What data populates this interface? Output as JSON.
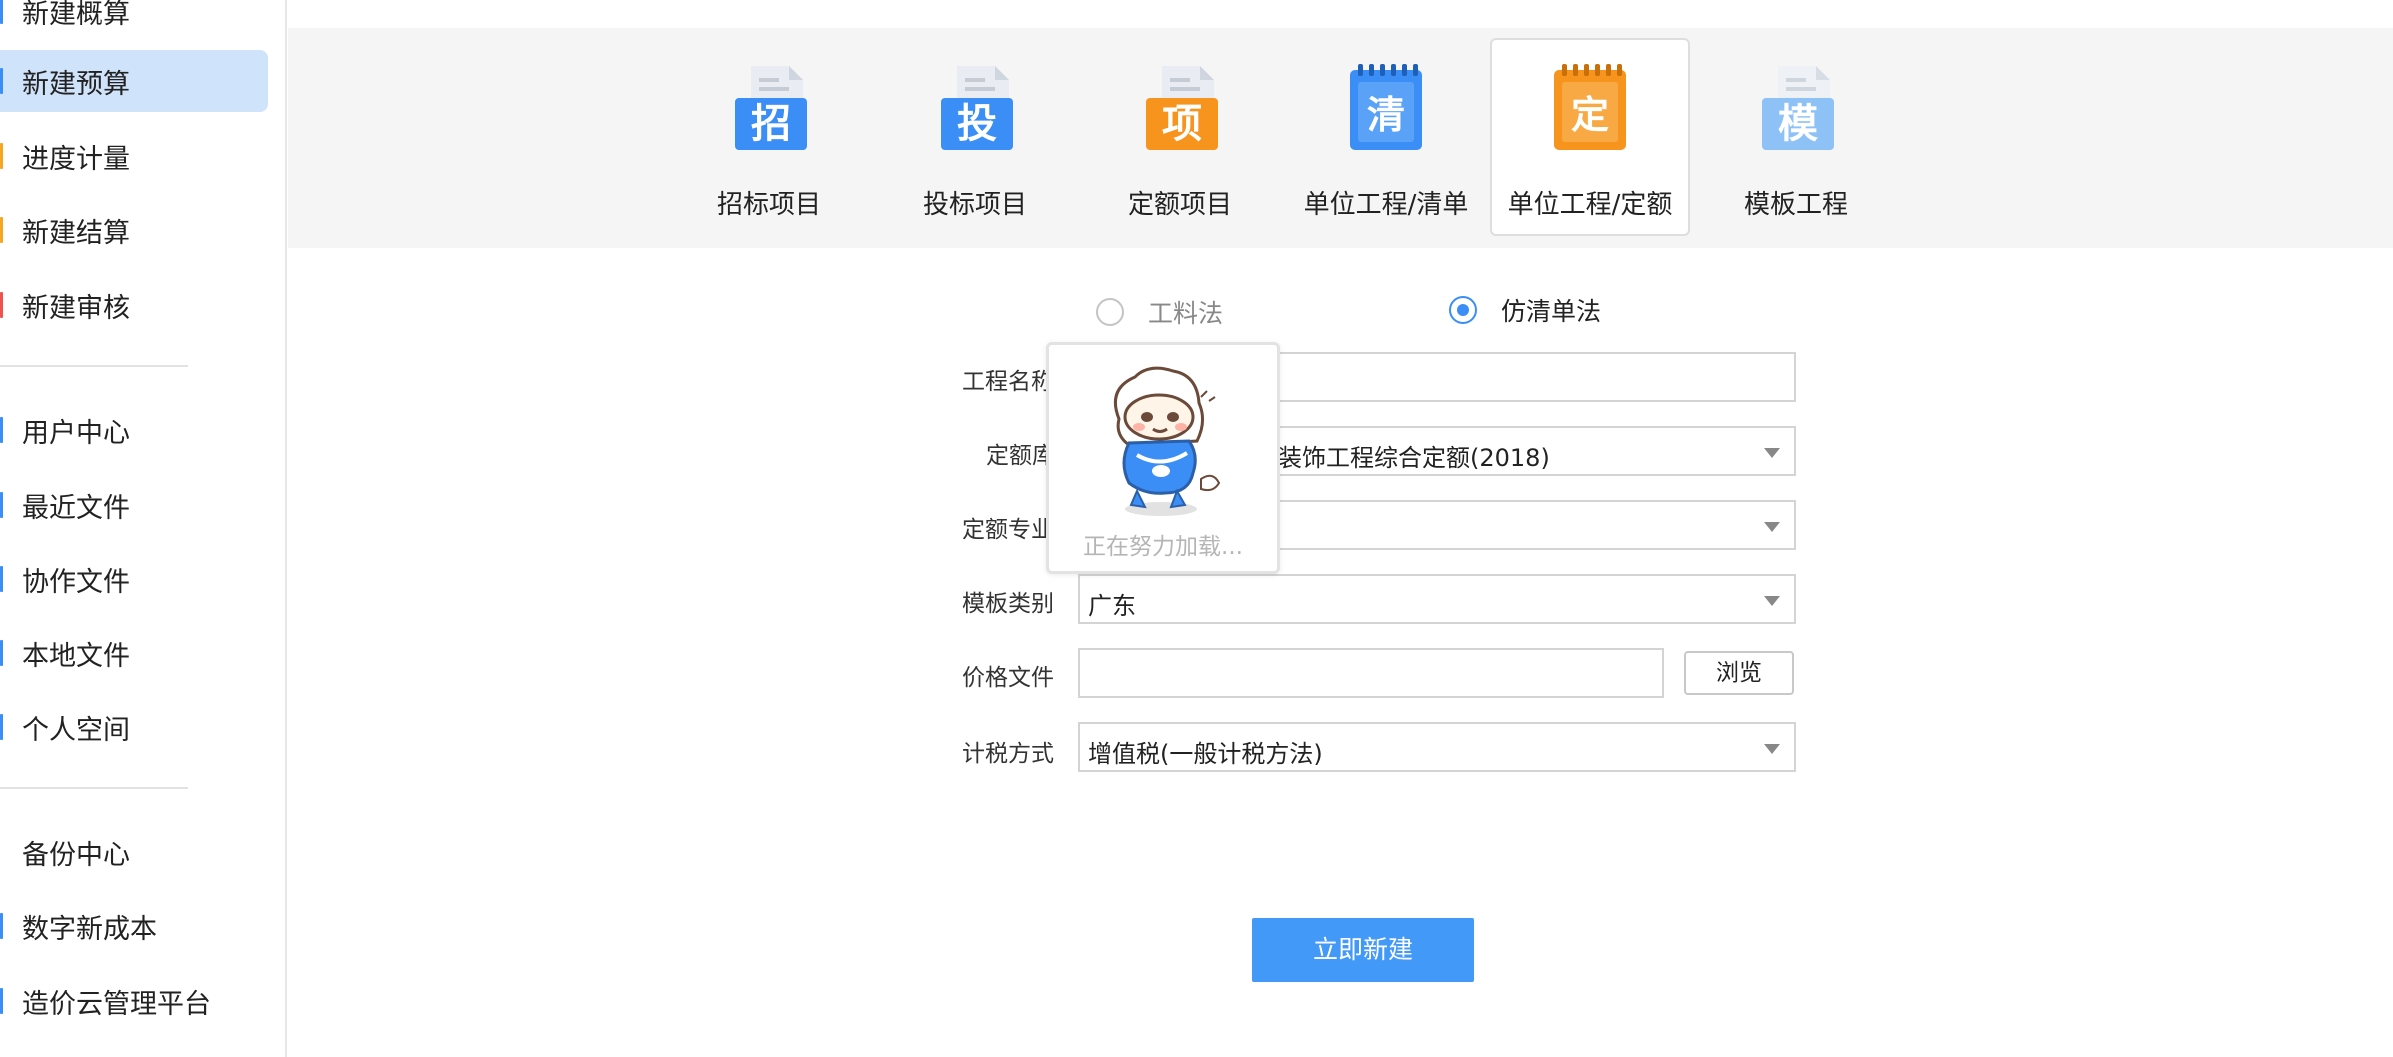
{
  "sidebar": {
    "items": [
      {
        "label": "新建概算",
        "mark": "#3a8ef6"
      },
      {
        "label": "新建预算",
        "mark": "#3a8ef6"
      },
      {
        "label": "进度计量",
        "mark": "#f5a623"
      },
      {
        "label": "新建结算",
        "mark": "#f5a623"
      },
      {
        "label": "新建审核",
        "mark": "#ef5350"
      },
      {
        "label": "用户中心",
        "mark": "#3a8ef6"
      },
      {
        "label": "最近文件",
        "mark": "#3a8ef6"
      },
      {
        "label": "协作文件",
        "mark": "#3a8ef6"
      },
      {
        "label": "本地文件",
        "mark": "#3a8ef6"
      },
      {
        "label": "个人空间",
        "mark": "#3a8ef6"
      },
      {
        "label": "备份中心",
        "mark": "#3a8ef6"
      },
      {
        "label": "数字新成本",
        "mark": "#3a8ef6"
      },
      {
        "label": "造价云管理平台",
        "mark": "#3a8ef6"
      }
    ],
    "active_index": 1
  },
  "project_types": [
    {
      "label": "招标项目",
      "glyph": "招",
      "icon": "tender-doc-icon",
      "color": "#3a8ef6"
    },
    {
      "label": "投标项目",
      "glyph": "投",
      "icon": "bid-doc-icon",
      "color": "#3a8ef6"
    },
    {
      "label": "定额项目",
      "glyph": "项",
      "icon": "quota-project-doc-icon",
      "color": "#f7941d"
    },
    {
      "label": "单位工程/清单",
      "glyph": "清",
      "icon": "bill-notebook-icon",
      "color": "#3a8ef6"
    },
    {
      "label": "单位工程/定额",
      "glyph": "定",
      "icon": "quota-notebook-icon",
      "color": "#f7941d"
    },
    {
      "label": "模板工程",
      "glyph": "模",
      "icon": "template-doc-icon",
      "color": "#8ec2f7"
    }
  ],
  "method": {
    "options": [
      "工料法",
      "仿清单法"
    ],
    "selected": "仿清单法"
  },
  "form": {
    "project_name_label": "工程名称",
    "quota_lib_label": "定额库",
    "quota_lib_value": "装饰工程综合定额(2018)",
    "quota_major_label": "定额专业",
    "template_label": "模板类别",
    "template_value": "广东",
    "price_file_label": "价格文件",
    "browse_label": "浏览",
    "tax_label": "计税方式",
    "tax_value": "增值税(一般计税方法)",
    "submit_label": "立即新建"
  },
  "loading": {
    "text": "正在努力加载..."
  },
  "colors": {
    "accent": "#3a8ef6",
    "orange": "#f7941d",
    "active_nav_bg": "#cfe3fb"
  }
}
